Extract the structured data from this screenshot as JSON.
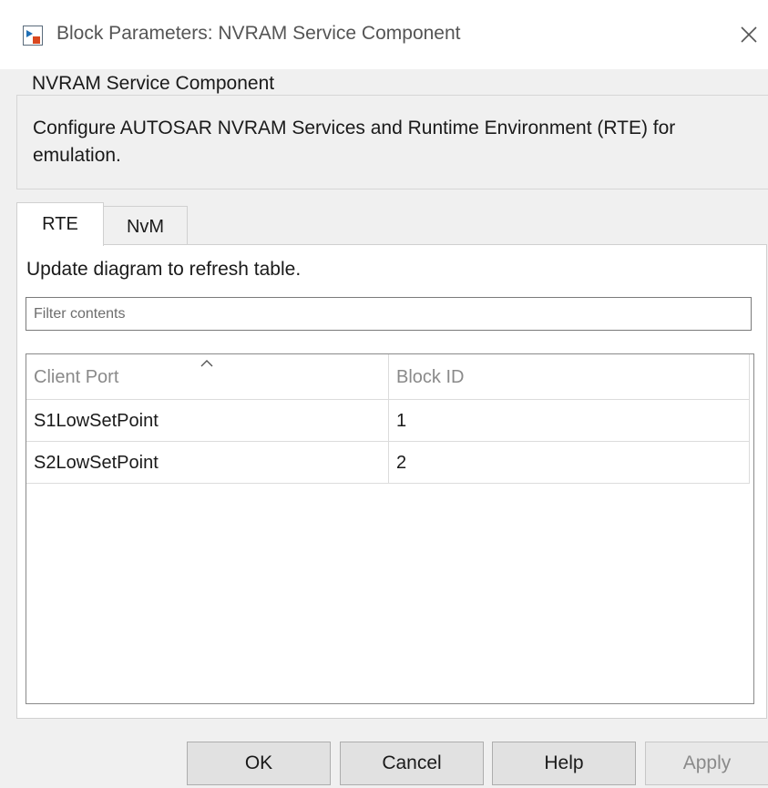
{
  "window": {
    "title": "Block Parameters: NVRAM Service Component",
    "icon": "simulink-block-icon",
    "close_icon": "close-icon"
  },
  "group": {
    "title": "NVRAM Service Component",
    "description": "Configure AUTOSAR NVRAM Services and Runtime Environment (RTE) for emulation."
  },
  "tabs": [
    {
      "label": "RTE",
      "selected": true
    },
    {
      "label": "NvM",
      "selected": false
    }
  ],
  "panel": {
    "hint": "Update diagram to refresh table.",
    "filter": {
      "placeholder": "Filter contents",
      "value": ""
    }
  },
  "table": {
    "columns": [
      "Client Port",
      "Block ID"
    ],
    "sort_icon": "sort-ascending-icon",
    "rows": [
      [
        "S1LowSetPoint",
        "1"
      ],
      [
        "S2LowSetPoint",
        "2"
      ]
    ]
  },
  "buttons": {
    "ok": "OK",
    "cancel": "Cancel",
    "help": "Help",
    "apply": "Apply"
  }
}
